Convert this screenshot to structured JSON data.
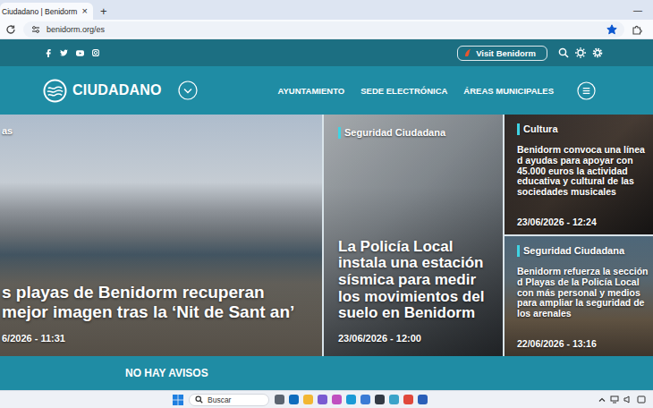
{
  "browser": {
    "tab": {
      "title": "Ciudadano | Benidorm",
      "close": "×"
    },
    "new_tab": "+",
    "minimize": "—",
    "url": "benidorm.org/es",
    "bookmarked": true
  },
  "site_header": {
    "visit_button": "Visit Benidorm"
  },
  "nav": {
    "logo": "CIUDADANO",
    "items": [
      "AYUNTAMIENTO",
      "SEDE ELECTRÓNICA",
      "ÁREAS MUNICIPALES"
    ]
  },
  "hero": {
    "main": {
      "category": "as",
      "title": "s playas de Benidorm recuperan mejor imagen tras la ‘Nit de Sant an’",
      "date": "6/2026 - 11:31"
    },
    "featured": {
      "category": "Seguridad Ciudadana",
      "title": "La Policía Local instala una estación sísmica para medir los movimientos del suelo en Benidorm",
      "date": "23/06/2026 - 12:00"
    },
    "side_cards": [
      {
        "category": "Cultura",
        "title": "Benidorm convoca una línea d ayudas para apoyar con 45.000 euros la actividad educativa y cultural de las sociedades musicales",
        "date": "23/06/2026 - 12:24"
      },
      {
        "category": "Seguridad Ciudadana",
        "title": "Benidorm refuerza la sección d Playas de la Policía Local con más personal y medios para ampliar la seguridad de los arenales",
        "date": "22/06/2026 - 13:16"
      }
    ]
  },
  "notices": "NO HAY AVISOS",
  "taskbar": {
    "search": "Buscar"
  }
}
